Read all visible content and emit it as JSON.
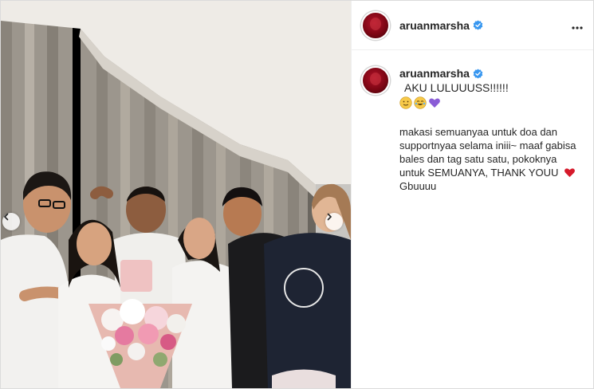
{
  "post": {
    "username": "aruanmarsha",
    "caption": {
      "headline": "AKU LULUUUSS!!!!!!",
      "emojis": [
        "smiling-face-emoji",
        "crying-laughing-face-emoji",
        "purple-heart-emoji"
      ],
      "body": "makasi semuanyaa untuk doa dan supportnyaa selama iniii~ maaf gabisa bales dan tag satu satu, pokoknya untuk SEMUANYA, THANK YOUU",
      "closing": "Gbuuuu"
    }
  },
  "photo": {
    "description_icons": [
      "chevron-left-icon",
      "chevron-right-icon"
    ]
  },
  "colors": {
    "verified": "#3897f0",
    "text": "#262626",
    "border": "#dbdbdb",
    "heart": "#d61a2b",
    "purple_heart": "#8a5cd6"
  }
}
